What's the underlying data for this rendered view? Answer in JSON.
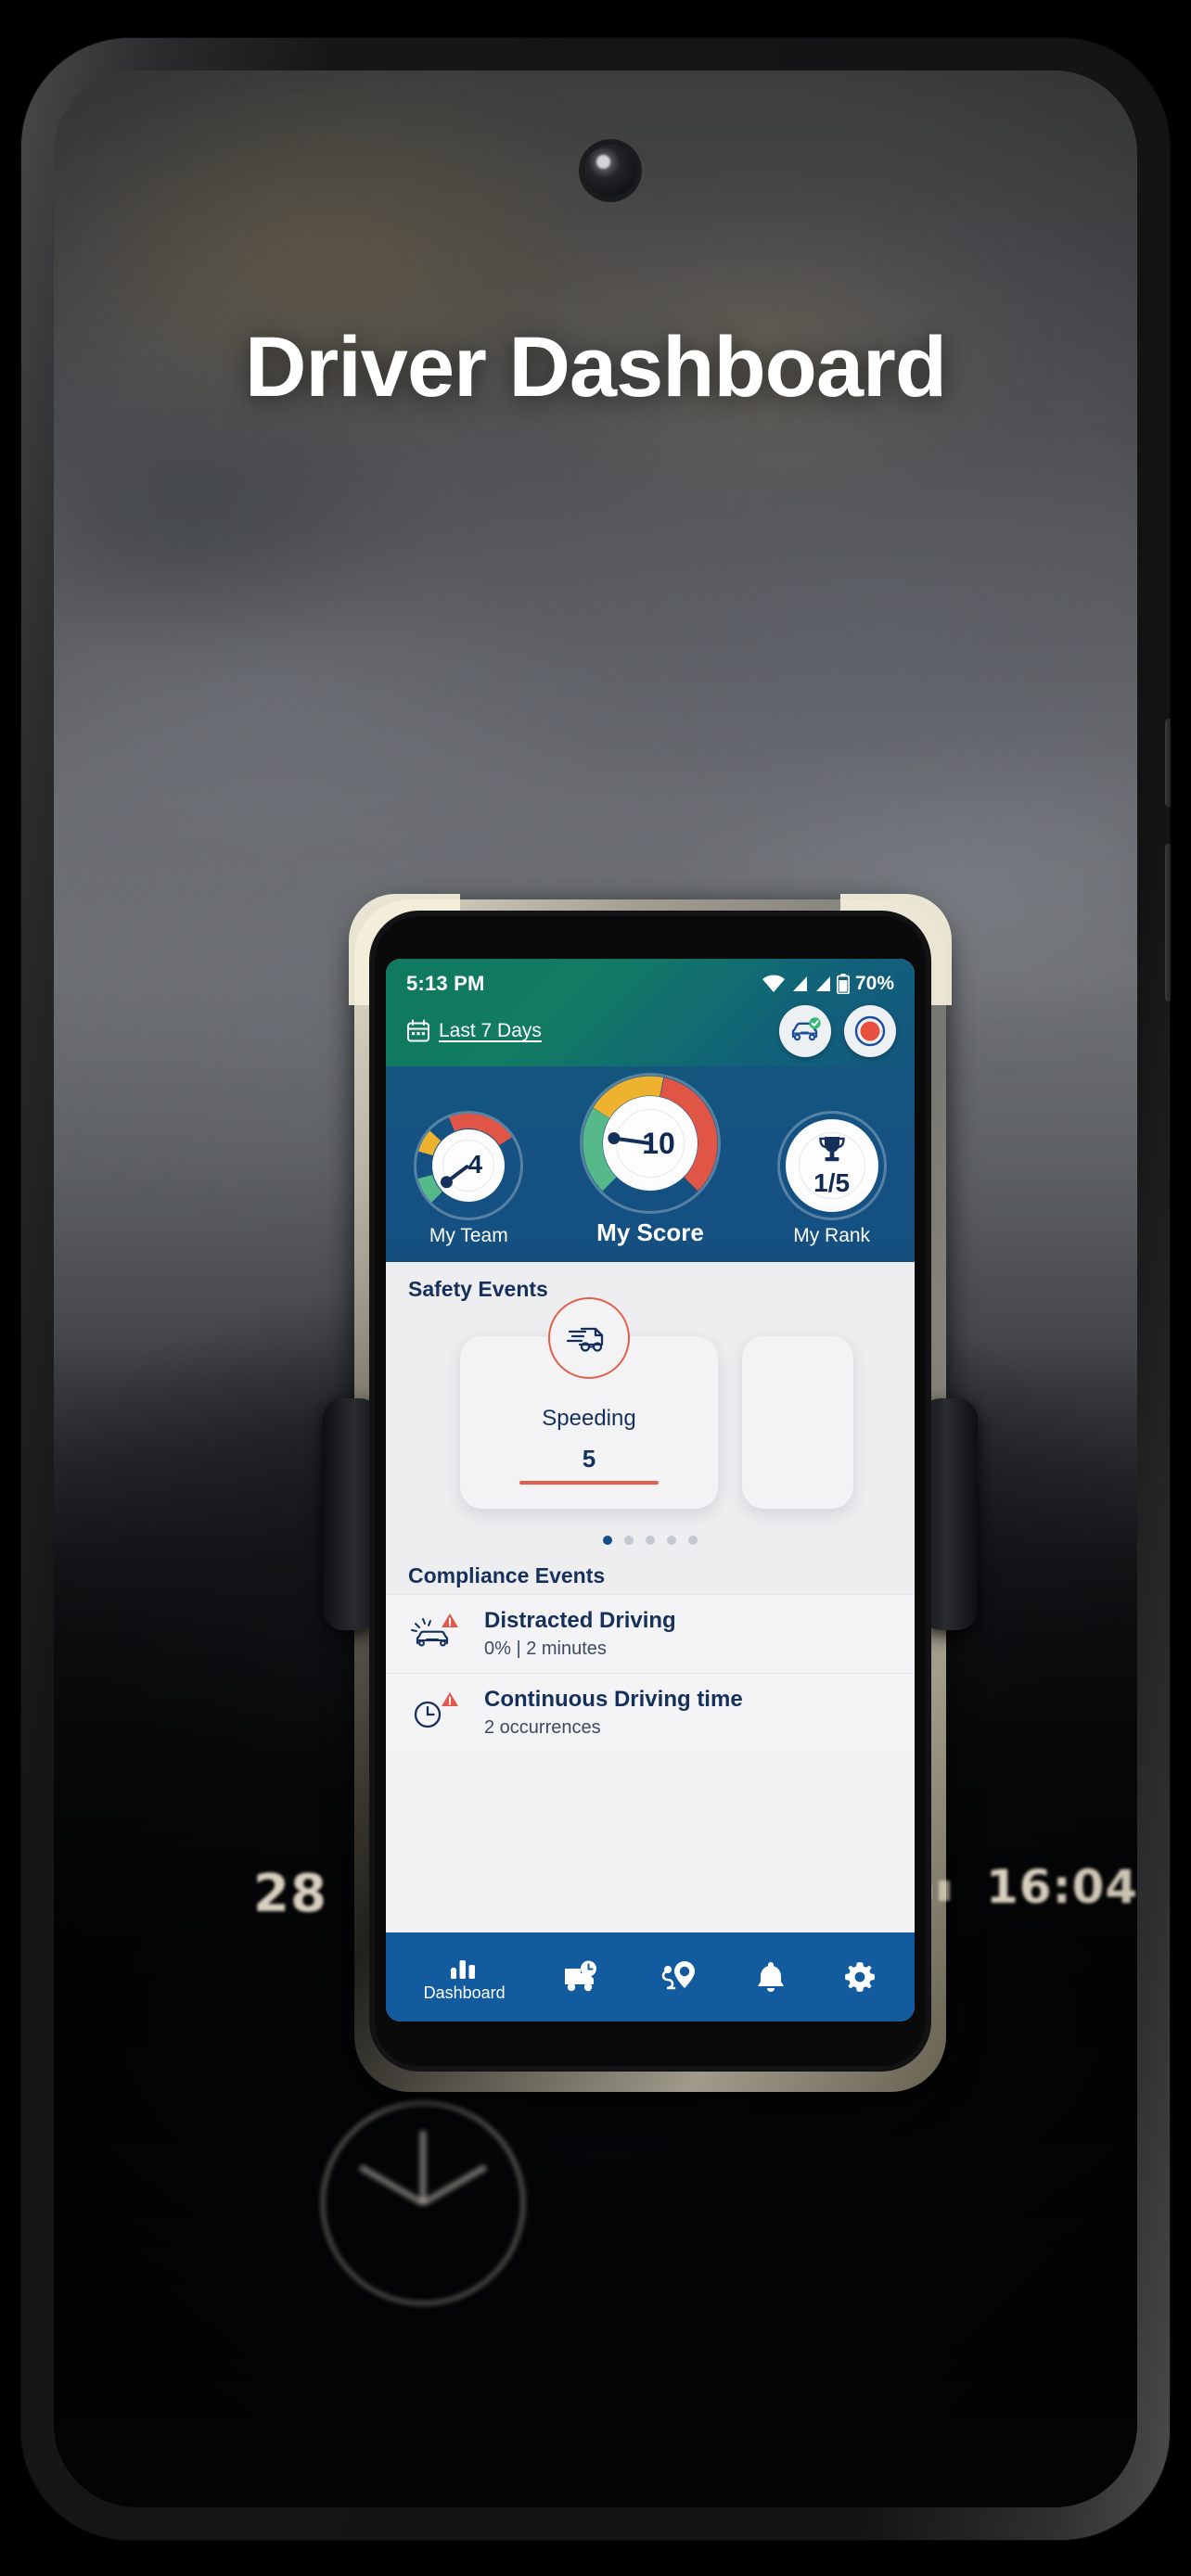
{
  "page": {
    "title": "Driver Dashboard"
  },
  "car_cluster": {
    "speed": "28",
    "clock": "16:04"
  },
  "phone": {
    "status_bar": {
      "time": "5:13 PM",
      "battery": "70%",
      "wifi_icon": "wifi-icon",
      "signal_icon_1": "signal-bars-icon",
      "signal_icon_2": "signal-bars-icon",
      "battery_icon": "battery-icon"
    },
    "header": {
      "date_filter_label": "Last 7 Days",
      "calendar_icon": "calendar-icon",
      "vehicle_check_icon": "car-check-icon",
      "record_icon": "record-button-icon"
    },
    "gauges": [
      {
        "label": "My Team",
        "value": "4",
        "primary": false,
        "needle_angle": 143,
        "arc": [
          {
            "color": "#55b98a",
            "from": 135,
            "to": 196
          },
          {
            "color": "#eeb22e",
            "from": 196,
            "to": 248
          },
          {
            "color": "#e05545",
            "from": 248,
            "to": 405
          }
        ]
      },
      {
        "label": "My Score",
        "value": "10",
        "primary": true,
        "needle_angle": 188,
        "arc": [
          {
            "color": "#55b98a",
            "from": 135,
            "to": 212
          },
          {
            "color": "#eeb22e",
            "from": 212,
            "to": 282
          },
          {
            "color": "#e05545",
            "from": 282,
            "to": 405
          }
        ]
      },
      {
        "label": "My Rank",
        "value": "1/5",
        "primary": false,
        "trophy_icon": "trophy-icon"
      }
    ],
    "safety_events": {
      "title": "Safety Events",
      "cards": [
        {
          "name": "Speeding",
          "value": "5",
          "icon": "speeding-truck-icon"
        },
        {
          "name": "",
          "value": "",
          "icon": ""
        }
      ],
      "dots_total": 5,
      "dots_active_index": 0
    },
    "compliance_events": {
      "title": "Compliance Events",
      "rows": [
        {
          "title": "Distracted Driving",
          "subtitle": "0% | 2 minutes",
          "icon": "distracted-driving-icon"
        },
        {
          "title": "Continuous Driving time",
          "subtitle": "2 occurrences",
          "icon": "clock-warning-icon"
        }
      ]
    },
    "bottom_nav": [
      {
        "label": "Dashboard",
        "icon": "bar-chart-icon",
        "active": true
      },
      {
        "label": "",
        "icon": "truck-clock-icon",
        "active": false
      },
      {
        "label": "",
        "icon": "route-pin-icon",
        "active": false
      },
      {
        "label": "",
        "icon": "bell-icon",
        "active": false
      },
      {
        "label": "",
        "icon": "gear-icon",
        "active": false
      }
    ]
  },
  "colors": {
    "header_teal": "#0f7a5f",
    "header_blue": "#14567e",
    "nav_blue": "#115b9e",
    "accent_red": "#e2604a",
    "navy_text": "#16305c",
    "gauge_green": "#55b98a",
    "gauge_yellow": "#eeb22e",
    "gauge_red": "#e05545"
  }
}
